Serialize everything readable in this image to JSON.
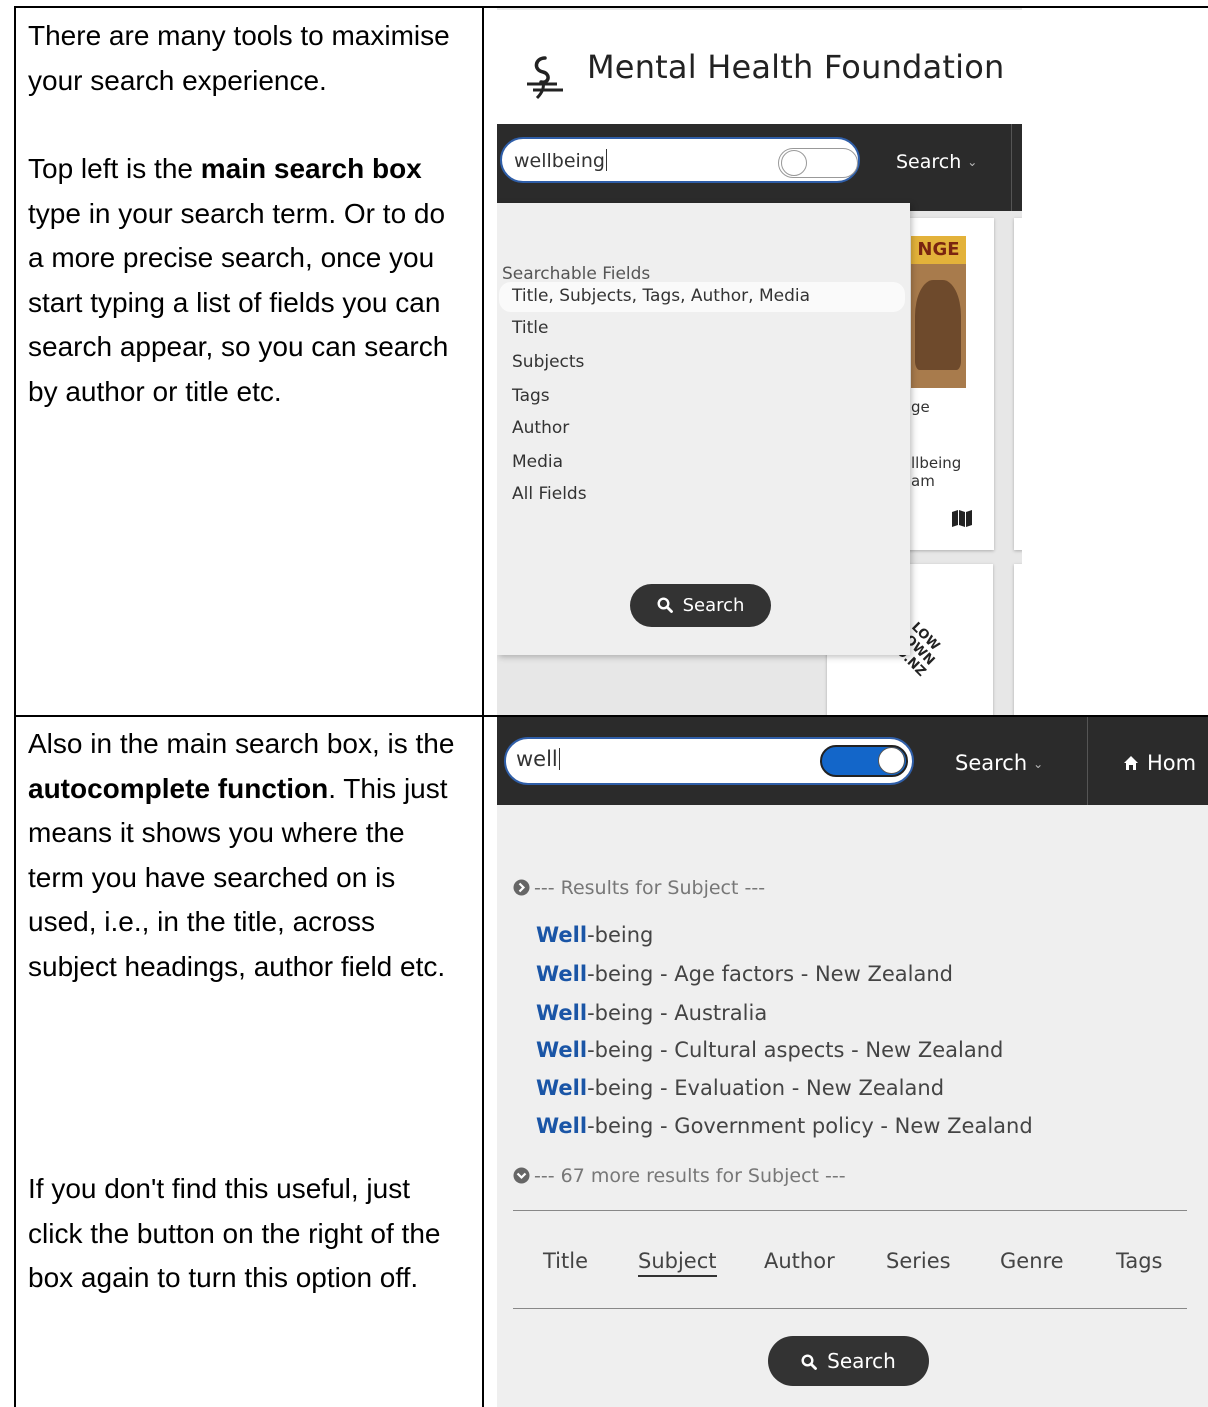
{
  "row1": {
    "intro": "There are many tools to maximise your search experience.",
    "p2_pre": "Top left is the ",
    "p2_bold": "main search box",
    "p2_post": " type in your search term. Or to do a more precise search, once you start typing a list of fields you can search appear, so you can search by author or title etc.",
    "shot": {
      "brand": "Mental Health Foundation",
      "search_value": "wellbeing",
      "nav_search": "Search",
      "dropdown_heading": "Searchable Fields",
      "fields": [
        "Title, Subjects, Tags, Author, Media",
        "Title",
        "Subjects",
        "Tags",
        "Author",
        "Media",
        "All Fields"
      ],
      "search_button": "Search",
      "card_cover_text": "NGE",
      "card_title_fragment": "ge",
      "card_line1": "llbeing",
      "card_line2": "am",
      "card_logo": "LOW DOWN .CO.NZ"
    }
  },
  "row2": {
    "p1_pre": "Also in the main search box, is the ",
    "p1_bold": "autocomplete function",
    "p1_post": ". This just means it shows you where the term you have searched on is used, i.e., in the title, across subject headings, author field etc.",
    "p2": "If you don't find this useful, just click the button on the right of the box again to turn this option off.",
    "shot": {
      "search_value": "well",
      "nav_search": "Search",
      "nav_home": "Hom",
      "results_heading": "--- Results for Subject ---",
      "results": [
        {
          "hl": "Well",
          "rest": "-being"
        },
        {
          "hl": "Well",
          "rest": "-being - Age factors - New Zealand"
        },
        {
          "hl": "Well",
          "rest": "-being - Australia"
        },
        {
          "hl": "Well",
          "rest": "-being - Cultural aspects - New Zealand"
        },
        {
          "hl": "Well",
          "rest": "-being - Evaluation - New Zealand"
        },
        {
          "hl": "Well",
          "rest": "-being - Government policy - New Zealand"
        }
      ],
      "more_results": "--- 67 more results for Subject ---",
      "tabs": [
        "Title",
        "Subject",
        "Author",
        "Series",
        "Genre",
        "Tags"
      ],
      "active_tab": "Subject",
      "search_button": "Search",
      "accent_color": "#1366c9"
    }
  }
}
